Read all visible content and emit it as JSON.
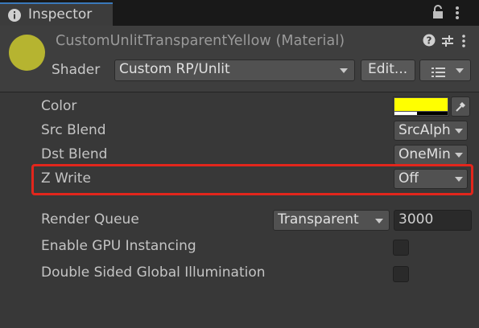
{
  "tab": {
    "label": "Inspector",
    "icon": "info-icon"
  },
  "tabbar": {
    "lock_icon": "lock-icon",
    "menu_icon": "kebab-menu-icon"
  },
  "header": {
    "material_title": "CustomUnlitTransparentYellow (Material)",
    "preview_color": "#b6b430",
    "help_icon": "help-icon",
    "settings_icon": "preset-sliders-icon",
    "more_icon": "kebab-menu-icon",
    "shader_label": "Shader",
    "shader_value": "Custom RP/Unlit",
    "edit_label": "Edit...",
    "list_icon": "list-menu-icon"
  },
  "properties": {
    "color": {
      "label": "Color",
      "value_hex": "#ffff00"
    },
    "src_blend": {
      "label": "Src Blend",
      "value": "SrcAlph"
    },
    "dst_blend": {
      "label": "Dst Blend",
      "value": "OneMin"
    },
    "z_write": {
      "label": "Z Write",
      "value": "Off",
      "highlight_color": "#e2261c"
    },
    "render_queue": {
      "label": "Render Queue",
      "mode": "Transparent",
      "value": "3000"
    },
    "gpu_instancing": {
      "label": "Enable GPU Instancing",
      "checked": false
    },
    "double_sided_gi": {
      "label": "Double Sided Global Illumination",
      "checked": false
    }
  }
}
